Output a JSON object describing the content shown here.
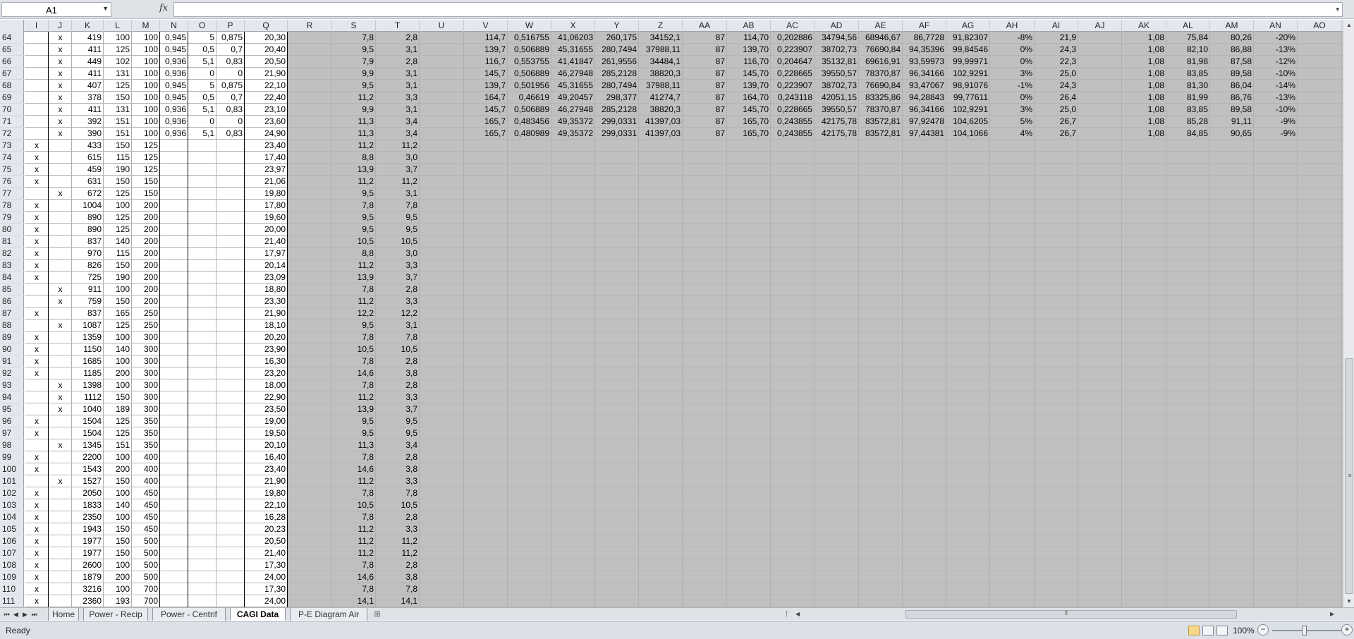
{
  "formula_bar": {
    "name_box": "A1",
    "fx_label": "fx",
    "formula": ""
  },
  "columns": [
    "I",
    "J",
    "K",
    "L",
    "M",
    "N",
    "O",
    "P",
    "Q",
    "R",
    "S",
    "T",
    "U",
    "V",
    "W",
    "X",
    "Y",
    "Z",
    "AA",
    "AB",
    "AC",
    "AD",
    "AE",
    "AF",
    "AG",
    "AH",
    "AI",
    "AJ",
    "AK",
    "AL",
    "AM",
    "AN",
    "AO"
  ],
  "rows": [
    {
      "n": "64",
      "I": "",
      "J": "x",
      "K": "419",
      "L": "100",
      "M": "100",
      "N": "0,945",
      "O": "5",
      "P": "0,875",
      "Q": "20,30",
      "S": "7,8",
      "T": "2,8",
      "V": "114,7",
      "W": "0,516755",
      "X": "41,06203",
      "Y": "260,175",
      "Z": "34152,1",
      "AA": "87",
      "AB": "114,70",
      "AC": "0,202886",
      "AD": "34794,56",
      "AE": "68946,67",
      "AF": "86,7728",
      "AG": "91,82307",
      "AH": "-8%",
      "AI": "21,9",
      "AK": "1,08",
      "AL": "75,84",
      "AM": "80,26",
      "AN": "-20%"
    },
    {
      "n": "65",
      "I": "",
      "J": "x",
      "K": "411",
      "L": "125",
      "M": "100",
      "N": "0,945",
      "O": "0,5",
      "P": "0,7",
      "Q": "20,40",
      "S": "9,5",
      "T": "3,1",
      "V": "139,7",
      "W": "0,506889",
      "X": "45,31655",
      "Y": "280,7494",
      "Z": "37988,11",
      "AA": "87",
      "AB": "139,70",
      "AC": "0,223907",
      "AD": "38702,73",
      "AE": "76690,84",
      "AF": "94,35396",
      "AG": "99,84546",
      "AH": "0%",
      "AI": "24,3",
      "AK": "1,08",
      "AL": "82,10",
      "AM": "86,88",
      "AN": "-13%"
    },
    {
      "n": "66",
      "I": "",
      "J": "x",
      "K": "449",
      "L": "102",
      "M": "100",
      "N": "0,936",
      "O": "5,1",
      "P": "0,83",
      "Q": "20,50",
      "S": "7,9",
      "T": "2,8",
      "V": "116,7",
      "W": "0,553755",
      "X": "41,41847",
      "Y": "261,9556",
      "Z": "34484,1",
      "AA": "87",
      "AB": "116,70",
      "AC": "0,204647",
      "AD": "35132,81",
      "AE": "69616,91",
      "AF": "93,59973",
      "AG": "99,99971",
      "AH": "0%",
      "AI": "22,3",
      "AK": "1,08",
      "AL": "81,98",
      "AM": "87,58",
      "AN": "-12%"
    },
    {
      "n": "67",
      "I": "",
      "J": "x",
      "K": "411",
      "L": "131",
      "M": "100",
      "N": "0,936",
      "O": "0",
      "P": "0",
      "Q": "21,90",
      "S": "9,9",
      "T": "3,1",
      "V": "145,7",
      "W": "0,506889",
      "X": "46,27948",
      "Y": "285,2128",
      "Z": "38820,3",
      "AA": "87",
      "AB": "145,70",
      "AC": "0,228665",
      "AD": "39550,57",
      "AE": "78370,87",
      "AF": "96,34166",
      "AG": "102,9291",
      "AH": "3%",
      "AI": "25,0",
      "AK": "1,08",
      "AL": "83,85",
      "AM": "89,58",
      "AN": "-10%"
    },
    {
      "n": "68",
      "I": "",
      "J": "x",
      "K": "407",
      "L": "125",
      "M": "100",
      "N": "0,945",
      "O": "5",
      "P": "0,875",
      "Q": "22,10",
      "S": "9,5",
      "T": "3,1",
      "V": "139,7",
      "W": "0,501956",
      "X": "45,31655",
      "Y": "280,7494",
      "Z": "37988,11",
      "AA": "87",
      "AB": "139,70",
      "AC": "0,223907",
      "AD": "38702,73",
      "AE": "76690,84",
      "AF": "93,47067",
      "AG": "98,91076",
      "AH": "-1%",
      "AI": "24,3",
      "AK": "1,08",
      "AL": "81,30",
      "AM": "86,04",
      "AN": "-14%"
    },
    {
      "n": "69",
      "I": "",
      "J": "x",
      "K": "378",
      "L": "150",
      "M": "100",
      "N": "0,945",
      "O": "0,5",
      "P": "0,7",
      "Q": "22,40",
      "S": "11,2",
      "T": "3,3",
      "V": "164,7",
      "W": "0,46619",
      "X": "49,20457",
      "Y": "298,377",
      "Z": "41274,7",
      "AA": "87",
      "AB": "164,70",
      "AC": "0,243118",
      "AD": "42051,15",
      "AE": "83325,86",
      "AF": "94,28843",
      "AG": "99,77611",
      "AH": "0%",
      "AI": "26,4",
      "AK": "1,08",
      "AL": "81,99",
      "AM": "86,76",
      "AN": "-13%"
    },
    {
      "n": "70",
      "I": "",
      "J": "x",
      "K": "411",
      "L": "131",
      "M": "100",
      "N": "0,936",
      "O": "5,1",
      "P": "0,83",
      "Q": "23,10",
      "S": "9,9",
      "T": "3,1",
      "V": "145,7",
      "W": "0,506889",
      "X": "46,27948",
      "Y": "285,2128",
      "Z": "38820,3",
      "AA": "87",
      "AB": "145,70",
      "AC": "0,228665",
      "AD": "39550,57",
      "AE": "78370,87",
      "AF": "96,34166",
      "AG": "102,9291",
      "AH": "3%",
      "AI": "25,0",
      "AK": "1,08",
      "AL": "83,85",
      "AM": "89,58",
      "AN": "-10%"
    },
    {
      "n": "71",
      "I": "",
      "J": "x",
      "K": "392",
      "L": "151",
      "M": "100",
      "N": "0,936",
      "O": "0",
      "P": "0",
      "Q": "23,60",
      "S": "11,3",
      "T": "3,4",
      "V": "165,7",
      "W": "0,483456",
      "X": "49,35372",
      "Y": "299,0331",
      "Z": "41397,03",
      "AA": "87",
      "AB": "165,70",
      "AC": "0,243855",
      "AD": "42175,78",
      "AE": "83572,81",
      "AF": "97,92478",
      "AG": "104,6205",
      "AH": "5%",
      "AI": "26,7",
      "AK": "1,08",
      "AL": "85,28",
      "AM": "91,11",
      "AN": "-9%"
    },
    {
      "n": "72",
      "I": "",
      "J": "x",
      "K": "390",
      "L": "151",
      "M": "100",
      "N": "0,936",
      "O": "5,1",
      "P": "0,83",
      "Q": "24,90",
      "S": "11,3",
      "T": "3,4",
      "V": "165,7",
      "W": "0,480989",
      "X": "49,35372",
      "Y": "299,0331",
      "Z": "41397,03",
      "AA": "87",
      "AB": "165,70",
      "AC": "0,243855",
      "AD": "42175,78",
      "AE": "83572,81",
      "AF": "97,44381",
      "AG": "104,1066",
      "AH": "4%",
      "AI": "26,7",
      "AK": "1,08",
      "AL": "84,85",
      "AM": "90,65",
      "AN": "-9%"
    },
    {
      "n": "73",
      "I": "x",
      "J": "",
      "K": "433",
      "L": "150",
      "M": "125",
      "Q": "23,40",
      "S": "11,2",
      "T": "11,2"
    },
    {
      "n": "74",
      "I": "x",
      "J": "",
      "K": "615",
      "L": "115",
      "M": "125",
      "Q": "17,40",
      "S": "8,8",
      "T": "3,0"
    },
    {
      "n": "75",
      "I": "x",
      "J": "",
      "K": "459",
      "L": "190",
      "M": "125",
      "Q": "23,97",
      "S": "13,9",
      "T": "3,7"
    },
    {
      "n": "76",
      "I": "x",
      "J": "",
      "K": "631",
      "L": "150",
      "M": "150",
      "Q": "21,06",
      "S": "11,2",
      "T": "11,2"
    },
    {
      "n": "77",
      "I": "",
      "J": "x",
      "K": "672",
      "L": "125",
      "M": "150",
      "Q": "19,80",
      "S": "9,5",
      "T": "3,1"
    },
    {
      "n": "78",
      "I": "x",
      "J": "",
      "K": "1004",
      "L": "100",
      "M": "200",
      "Q": "17,80",
      "S": "7,8",
      "T": "7,8"
    },
    {
      "n": "79",
      "I": "x",
      "J": "",
      "K": "890",
      "L": "125",
      "M": "200",
      "Q": "19,60",
      "S": "9,5",
      "T": "9,5"
    },
    {
      "n": "80",
      "I": "x",
      "J": "",
      "K": "890",
      "L": "125",
      "M": "200",
      "Q": "20,00",
      "S": "9,5",
      "T": "9,5"
    },
    {
      "n": "81",
      "I": "x",
      "J": "",
      "K": "837",
      "L": "140",
      "M": "200",
      "Q": "21,40",
      "S": "10,5",
      "T": "10,5"
    },
    {
      "n": "82",
      "I": "x",
      "J": "",
      "K": "970",
      "L": "115",
      "M": "200",
      "Q": "17,97",
      "S": "8,8",
      "T": "3,0"
    },
    {
      "n": "83",
      "I": "x",
      "J": "",
      "K": "826",
      "L": "150",
      "M": "200",
      "Q": "20,14",
      "S": "11,2",
      "T": "3,3"
    },
    {
      "n": "84",
      "I": "x",
      "J": "",
      "K": "725",
      "L": "190",
      "M": "200",
      "Q": "23,09",
      "S": "13,9",
      "T": "3,7"
    },
    {
      "n": "85",
      "I": "",
      "J": "x",
      "K": "911",
      "L": "100",
      "M": "200",
      "Q": "18,80",
      "S": "7,8",
      "T": "2,8"
    },
    {
      "n": "86",
      "I": "",
      "J": "x",
      "K": "759",
      "L": "150",
      "M": "200",
      "Q": "23,30",
      "S": "11,2",
      "T": "3,3"
    },
    {
      "n": "87",
      "I": "x",
      "J": "",
      "K": "837",
      "L": "165",
      "M": "250",
      "Q": "21,90",
      "S": "12,2",
      "T": "12,2"
    },
    {
      "n": "88",
      "I": "",
      "J": "x",
      "K": "1087",
      "L": "125",
      "M": "250",
      "Q": "18,10",
      "S": "9,5",
      "T": "3,1"
    },
    {
      "n": "89",
      "I": "x",
      "J": "",
      "K": "1359",
      "L": "100",
      "M": "300",
      "Q": "20,20",
      "S": "7,8",
      "T": "7,8"
    },
    {
      "n": "90",
      "I": "x",
      "J": "",
      "K": "1150",
      "L": "140",
      "M": "300",
      "Q": "23,90",
      "S": "10,5",
      "T": "10,5"
    },
    {
      "n": "91",
      "I": "x",
      "J": "",
      "K": "1685",
      "L": "100",
      "M": "300",
      "Q": "16,30",
      "S": "7,8",
      "T": "2,8"
    },
    {
      "n": "92",
      "I": "x",
      "J": "",
      "K": "1185",
      "L": "200",
      "M": "300",
      "Q": "23,20",
      "S": "14,6",
      "T": "3,8"
    },
    {
      "n": "93",
      "I": "",
      "J": "x",
      "K": "1398",
      "L": "100",
      "M": "300",
      "Q": "18,00",
      "S": "7,8",
      "T": "2,8"
    },
    {
      "n": "94",
      "I": "",
      "J": "x",
      "K": "1112",
      "L": "150",
      "M": "300",
      "Q": "22,90",
      "S": "11,2",
      "T": "3,3"
    },
    {
      "n": "95",
      "I": "",
      "J": "x",
      "K": "1040",
      "L": "189",
      "M": "300",
      "Q": "23,50",
      "S": "13,9",
      "T": "3,7"
    },
    {
      "n": "96",
      "I": "x",
      "J": "",
      "K": "1504",
      "L": "125",
      "M": "350",
      "Q": "19,00",
      "S": "9,5",
      "T": "9,5"
    },
    {
      "n": "97",
      "I": "x",
      "J": "",
      "K": "1504",
      "L": "125",
      "M": "350",
      "Q": "19,50",
      "S": "9,5",
      "T": "9,5"
    },
    {
      "n": "98",
      "I": "",
      "J": "x",
      "K": "1345",
      "L": "151",
      "M": "350",
      "Q": "20,10",
      "S": "11,3",
      "T": "3,4"
    },
    {
      "n": "99",
      "I": "x",
      "J": "",
      "K": "2200",
      "L": "100",
      "M": "400",
      "Q": "16,40",
      "S": "7,8",
      "T": "2,8"
    },
    {
      "n": "100",
      "I": "x",
      "J": "",
      "K": "1543",
      "L": "200",
      "M": "400",
      "Q": "23,40",
      "S": "14,6",
      "T": "3,8"
    },
    {
      "n": "101",
      "I": "",
      "J": "x",
      "K": "1527",
      "L": "150",
      "M": "400",
      "Q": "21,90",
      "S": "11,2",
      "T": "3,3"
    },
    {
      "n": "102",
      "I": "x",
      "J": "",
      "K": "2050",
      "L": "100",
      "M": "450",
      "Q": "19,80",
      "S": "7,8",
      "T": "7,8"
    },
    {
      "n": "103",
      "I": "x",
      "J": "",
      "K": "1833",
      "L": "140",
      "M": "450",
      "Q": "22,10",
      "S": "10,5",
      "T": "10,5"
    },
    {
      "n": "104",
      "I": "x",
      "J": "",
      "K": "2350",
      "L": "100",
      "M": "450",
      "Q": "16,28",
      "S": "7,8",
      "T": "2,8"
    },
    {
      "n": "105",
      "I": "x",
      "J": "",
      "K": "1943",
      "L": "150",
      "M": "450",
      "Q": "20,23",
      "S": "11,2",
      "T": "3,3"
    },
    {
      "n": "106",
      "I": "x",
      "J": "",
      "K": "1977",
      "L": "150",
      "M": "500",
      "Q": "20,50",
      "S": "11,2",
      "T": "11,2"
    },
    {
      "n": "107",
      "I": "x",
      "J": "",
      "K": "1977",
      "L": "150",
      "M": "500",
      "Q": "21,40",
      "S": "11,2",
      "T": "11,2"
    },
    {
      "n": "108",
      "I": "x",
      "J": "",
      "K": "2600",
      "L": "100",
      "M": "500",
      "Q": "17,30",
      "S": "7,8",
      "T": "2,8"
    },
    {
      "n": "109",
      "I": "x",
      "J": "",
      "K": "1879",
      "L": "200",
      "M": "500",
      "Q": "24,00",
      "S": "14,6",
      "T": "3,8"
    },
    {
      "n": "110",
      "I": "x",
      "J": "",
      "K": "3216",
      "L": "100",
      "M": "700",
      "Q": "17,30",
      "S": "7,8",
      "T": "7,8"
    },
    {
      "n": "111",
      "I": "x",
      "J": "",
      "K": "2360",
      "L": "193",
      "M": "700",
      "Q": "24,00",
      "S": "14,1",
      "T": "14,1"
    }
  ],
  "sheet_tabs": [
    "Home",
    "Power - Recip",
    "Power - Centrif",
    "CAGI Data",
    "P-E Diagram Air"
  ],
  "active_sheet": "CAGI Data",
  "status": {
    "text": "Ready",
    "zoom": "100%"
  },
  "colors": {
    "grid_bg": "#c0c0c0",
    "header_bg": "#e4e8ee",
    "active_tab": "#ffffff",
    "chrome": "#dfe3e8"
  },
  "icons": [
    "fx-icon",
    "dropdown-arrow-icon",
    "first-sheet-icon",
    "prev-sheet-icon",
    "next-sheet-icon",
    "last-sheet-icon",
    "insert-sheet-icon",
    "normal-view-icon",
    "page-layout-icon",
    "page-break-icon",
    "zoom-out-icon",
    "zoom-in-icon"
  ]
}
